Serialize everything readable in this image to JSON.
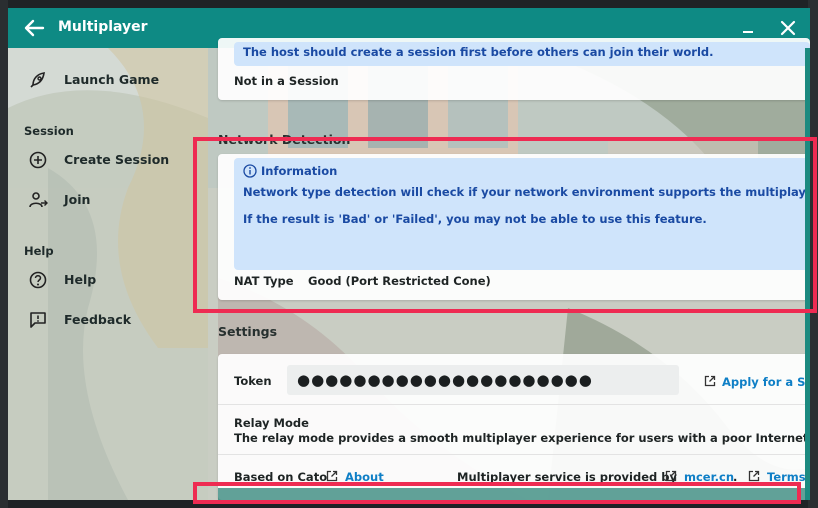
{
  "window": {
    "title": "Multiplayer",
    "accent": "#0e8a84"
  },
  "sidebar": {
    "launch_label": "Launch Game",
    "sections": [
      {
        "title": "Session",
        "items": [
          {
            "label": "Create Session",
            "icon": "plus-circle-icon"
          },
          {
            "label": "Join",
            "icon": "person-join-icon"
          }
        ]
      },
      {
        "title": "Help",
        "items": [
          {
            "label": "Help",
            "icon": "question-circle-icon"
          },
          {
            "label": "Feedback",
            "icon": "feedback-icon"
          }
        ]
      }
    ]
  },
  "session_card": {
    "hint": "The host should create a session first before others can join their world.",
    "status": "Not in a Session"
  },
  "network": {
    "heading": "Network Detection",
    "info_title": "Information",
    "info_line1": "Network type detection will check if your network environment supports the multiplayer function.",
    "info_line2": "If the result is 'Bad' or 'Failed', you may not be able to use this feature.",
    "nat_label": "NAT Type",
    "nat_value": "Good (Port Restricted Cone)"
  },
  "settings": {
    "heading": "Settings",
    "token_label": "Token",
    "token_value": "●●●●●●●●●●●●●●●●●●●●●",
    "apply_link": "Apply for a Static Token",
    "relay_title": "Relay Mode",
    "relay_desc": "The relay mode provides a smooth multiplayer experience for users with a poor Internet connection."
  },
  "footer": {
    "based_on": "Based on Cato",
    "about_link": "About",
    "provided_by": "Multiplayer service is provided by",
    "provider_link": "mcer.cn",
    "dot": ".",
    "terms_link": "Terms"
  },
  "colors": {
    "highlight": "#ee2b52",
    "info_bg": "#cfe4fb",
    "info_text": "#1a4aa3",
    "link": "#0f7fc6"
  }
}
